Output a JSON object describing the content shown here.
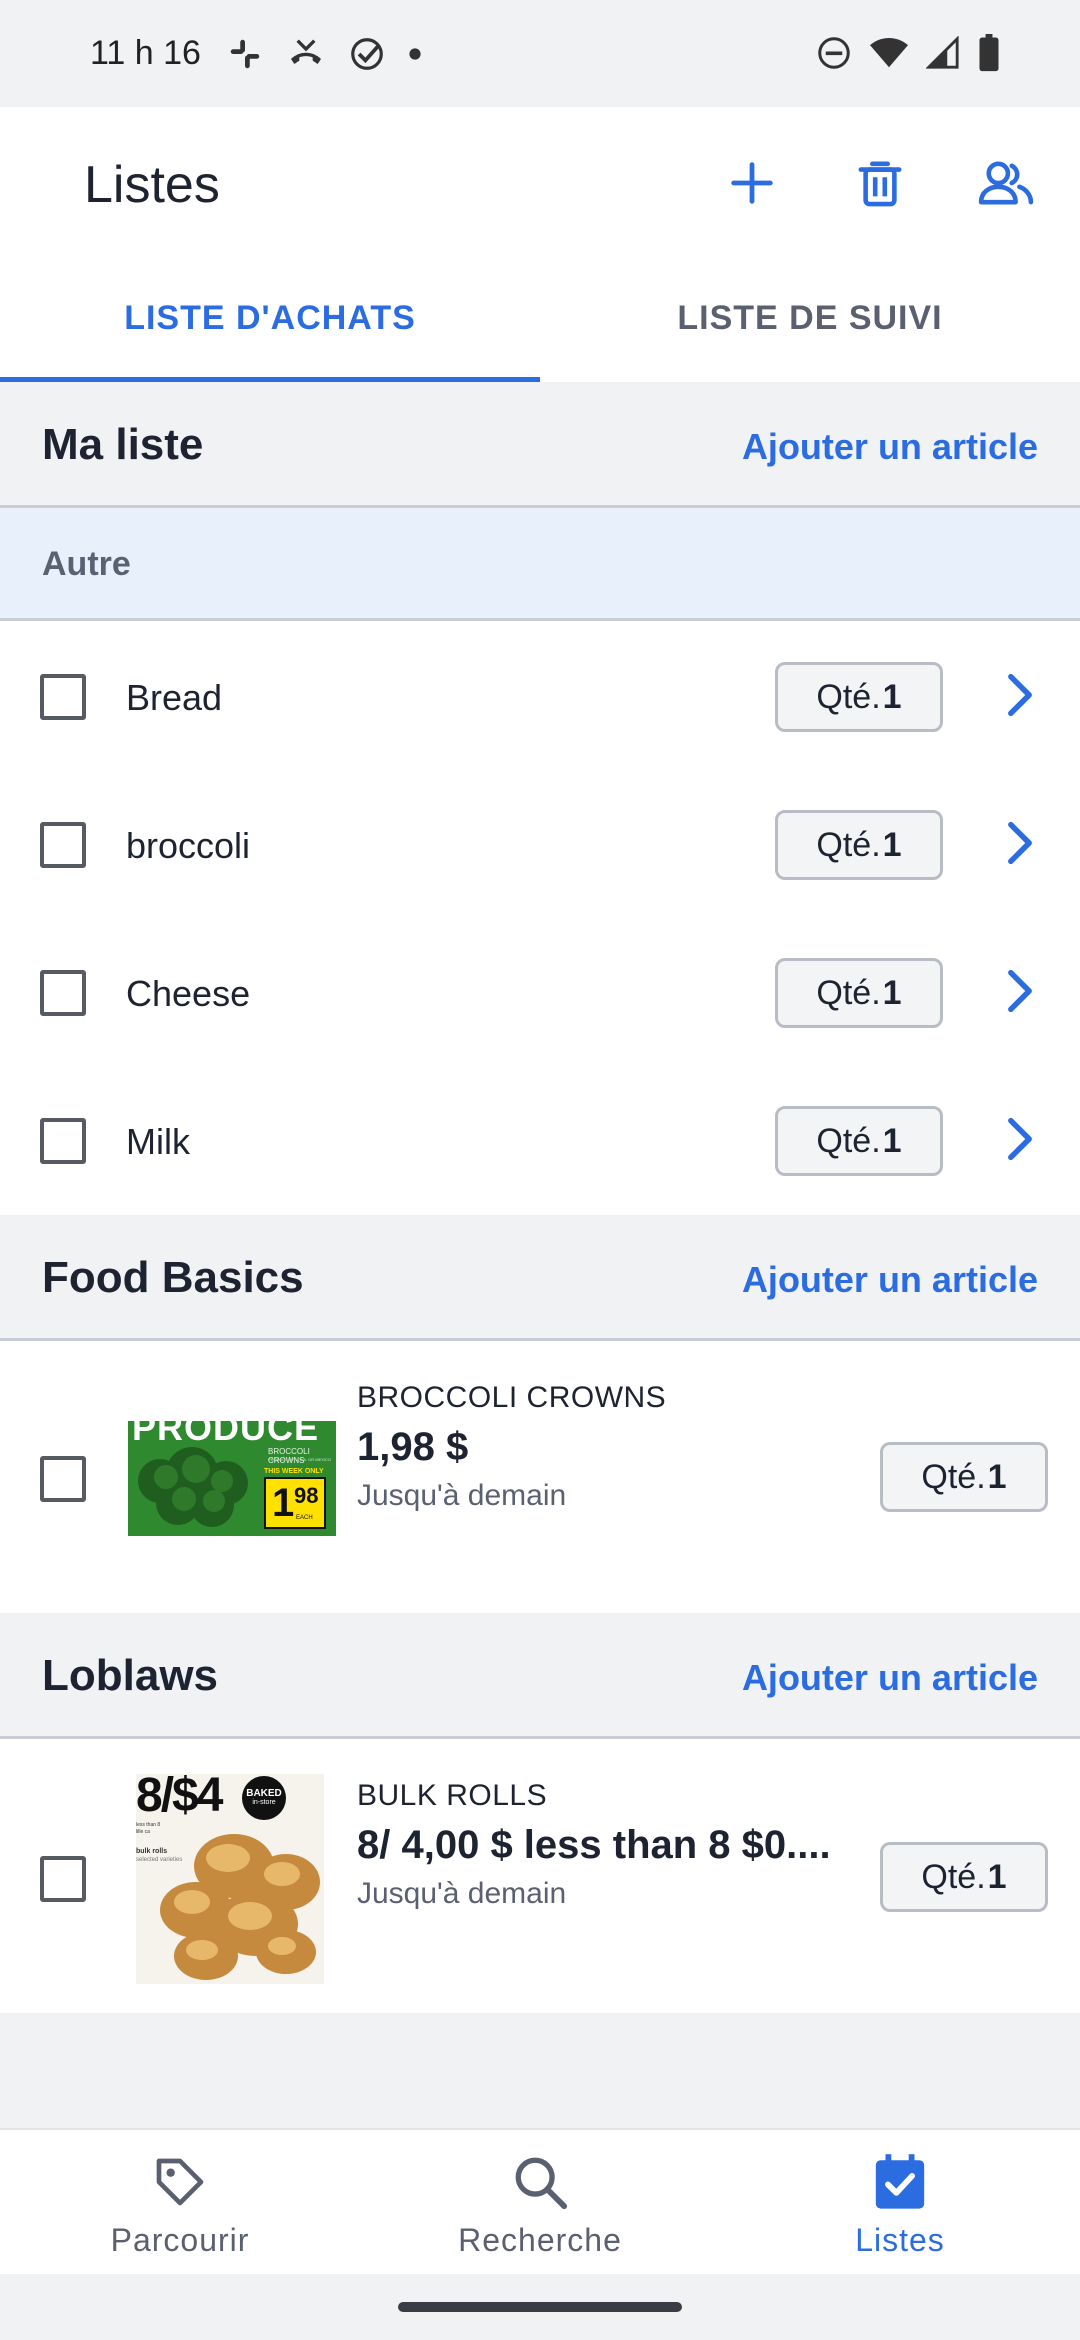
{
  "status_bar": {
    "time": "11 h 16"
  },
  "app_bar": {
    "title": "Listes",
    "add_icon": "plus-icon",
    "delete_icon": "trash-icon",
    "share_icon": "people-icon"
  },
  "tabs": [
    {
      "label": "LISTE D'ACHATS",
      "active": true
    },
    {
      "label": "LISTE DE SUIVI",
      "active": false
    }
  ],
  "sections": {
    "my_list": {
      "title": "Ma liste",
      "add_link": "Ajouter un article",
      "group": "Autre",
      "items": [
        {
          "name": "Bread",
          "qty_label": "Qté.",
          "qty": "1"
        },
        {
          "name": "broccoli",
          "qty_label": "Qté.",
          "qty": "1"
        },
        {
          "name": "Cheese",
          "qty_label": "Qté.",
          "qty": "1"
        },
        {
          "name": "Milk",
          "qty_label": "Qté.",
          "qty": "1"
        }
      ]
    },
    "food_basics": {
      "title": "Food Basics",
      "add_link": "Ajouter un article",
      "deal": {
        "name": "BROCCOLI CROWNS",
        "price": "1,98 $",
        "until": "Jusqu'à demain",
        "qty_label": "Qté.",
        "qty": "1",
        "image": {
          "banner_text": "PRODUCE",
          "small_title": "BROCCOLI CROWNS",
          "small_sub": "PRODUCT OF U.S.A. OR MEXICO",
          "tag": "THIS WEEK ONLY",
          "price_big": "1",
          "price_small": "98",
          "price_unit": "EACH"
        }
      }
    },
    "loblaws": {
      "title": "Loblaws",
      "add_link": "Ajouter un article",
      "deal": {
        "name": "BULK ROLLS",
        "price": "8/ 4,00 $ less than 8 $0....",
        "until": "Jusqu'à demain",
        "qty_label": "Qté.",
        "qty": "1",
        "image": {
          "price_big": "8/$4",
          "badge_top": "BAKED",
          "badge_bottom": "in-store",
          "small_lines": "less than 8 lille ca",
          "caption": "bulk rolls",
          "caption_sub": "selected varieties"
        }
      }
    }
  },
  "bottom_nav": [
    {
      "label": "Parcourir",
      "icon": "tag-icon",
      "active": false
    },
    {
      "label": "Recherche",
      "icon": "search-icon",
      "active": false
    },
    {
      "label": "Listes",
      "icon": "calendar-check-icon",
      "active": true
    }
  ],
  "colors": {
    "accent": "#2b6ce0",
    "group_bg": "#e8f0fc",
    "background": "#f1f2f4"
  }
}
